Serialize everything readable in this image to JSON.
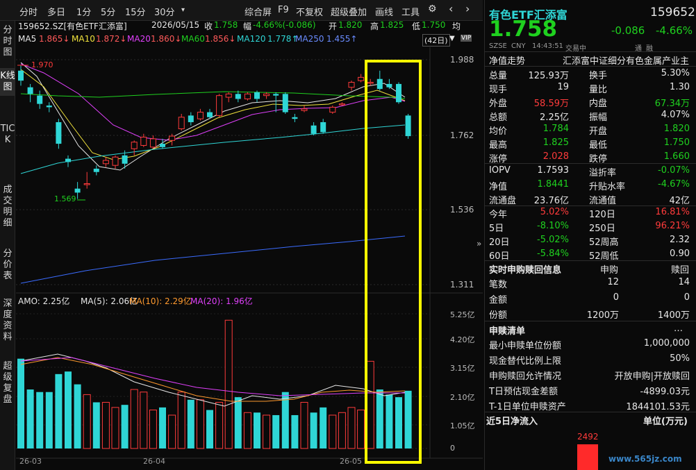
{
  "toolbar": {
    "tabs": [
      "分时",
      "多日",
      "1分",
      "5分",
      "15分",
      "30分"
    ],
    "more_icon": "▾",
    "right_items": [
      "综合屏",
      "F9",
      "不复权",
      "超级叠加",
      "画线",
      "工具"
    ],
    "gear_icon": "⚙",
    "nav_icons": [
      "‹",
      "›"
    ]
  },
  "vtabs": [
    "分时图",
    "K线图",
    "TICK",
    "成交明细",
    "分价表",
    "深度资料",
    "超级复盘"
  ],
  "info": {
    "code_name": "159652.SZ[有色ETF汇添富]",
    "date": "2026/05/15",
    "close_label": "收",
    "close": "1.758",
    "amp_label": "幅",
    "amp": "-4.66%(-0.086)",
    "open_label": "开",
    "open": "1.820",
    "high_label": "高",
    "high": "1.825",
    "low_label": "低",
    "low": "1.750",
    "more": "均"
  },
  "ma": {
    "ma5_label": "MA5",
    "ma5": "1.865↓",
    "ma10_label": "MA10",
    "ma10": "1.872↓",
    "ma20_label": "MA20",
    "ma20": "1.860↓",
    "ma60_label": "MA60",
    "ma60": "1.856↓",
    "ma120_label": "MA120",
    "ma120": "1.778↑",
    "ma250_label": "MA250",
    "ma250": "1.455↑",
    "period": "(42日)",
    "colors": {
      "ma5": "#e8e8e8",
      "ma10": "#f0e23c",
      "ma20": "#e040fb",
      "ma60": "#1fd11f",
      "ma120": "#2fd6d6",
      "ma250": "#3b6cff"
    }
  },
  "price_axis": [
    "1.988",
    "1.762",
    "1.536",
    "1.311"
  ],
  "annot": {
    "high": "1.970",
    "low": "1.569"
  },
  "amo": {
    "amo_label": "AMO: 2.25亿",
    "ma5_label": "MA(5): 2.06亿",
    "ma10_label": "MA(10): 2.29亿",
    "ma20_label": "MA(20): 1.96亿"
  },
  "vol_axis": [
    "5.25亿",
    "4.20亿",
    "3.15亿",
    "2.10亿",
    "1.05亿",
    "0"
  ],
  "date_axis": [
    "26-03",
    "26-04",
    "26-05"
  ],
  "stock": {
    "name": "有色ETF汇添富",
    "code": "159652",
    "price": "1.758",
    "change": "-0.086",
    "change_pct": "-4.66%",
    "market": "SZSE",
    "currency": "CNY",
    "time": "14:43:51",
    "status": "交易中",
    "flags": [
      "通",
      "融"
    ]
  },
  "panel": {
    "nav_label": "净值走势",
    "nav_desc": "汇添富中证细分有色金属产业主",
    "rows_a": [
      {
        "k1": "总量",
        "v1": "125.93万",
        "k2": "换手",
        "v2": "5.30%"
      },
      {
        "k1": "现手",
        "v1": "19",
        "k2": "量比",
        "v2": "1.30"
      },
      {
        "k1": "外盘",
        "v1": "58.59万",
        "k2": "内盘",
        "v2": "67.34万"
      },
      {
        "k1": "总额",
        "v1": "2.25亿",
        "k2": "振幅",
        "v2": "4.07%"
      },
      {
        "k1": "均价",
        "v1": "1.784",
        "k2": "开盘",
        "v2": "1.820"
      },
      {
        "k1": "最高",
        "v1": "1.825",
        "k2": "最低",
        "v2": "1.750"
      },
      {
        "k1": "涨停",
        "v1": "2.028",
        "k2": "跌停",
        "v2": "1.660"
      }
    ],
    "rows_b": [
      {
        "k1": "IOPV",
        "v1": "1.7593",
        "k2": "溢折率",
        "v2": "-0.07%"
      },
      {
        "k1": "净值",
        "v1": "1.8441",
        "k2": "升贴水率",
        "v2": "-4.67%"
      },
      {
        "k1": "流通盘",
        "v1": "23.76亿",
        "k2": "流通值",
        "v2": "42亿"
      }
    ],
    "rows_c": [
      {
        "k1": "今年",
        "v1": "5.02%",
        "k2": "120日",
        "v2": "16.81%"
      },
      {
        "k1": "5日",
        "v1": "-8.10%",
        "k2": "250日",
        "v2": "96.21%"
      },
      {
        "k1": "20日",
        "v1": "-5.02%",
        "k2": "52周高",
        "v2": "2.32"
      },
      {
        "k1": "60日",
        "v1": "-5.84%",
        "k2": "52周低",
        "v2": "0.90"
      }
    ],
    "sub_title": "实时申购赎回信息",
    "sub_col1": "申购",
    "sub_col2": "赎回",
    "sub_rows": [
      {
        "k": "笔数",
        "v1": "12",
        "v2": "14"
      },
      {
        "k": "金额",
        "v1": "0",
        "v2": "0"
      },
      {
        "k": "份额",
        "v1": "1200万",
        "v2": "1400万"
      }
    ],
    "list_title": "申赎清单",
    "list_more": "…",
    "list_rows": [
      {
        "k": "最小申赎单位份额",
        "v": "1,000,000"
      },
      {
        "k": "现金替代比例上限",
        "v": "50%"
      },
      {
        "k": "申购赎回允许情况",
        "v": "开放申购|开放赎回"
      },
      {
        "k": "T日预估现金差额",
        "v": "-4899.03元"
      },
      {
        "k": "T-1日单位申赎资产",
        "v": "1844101.53元"
      }
    ],
    "flow_title": "近5日净流入",
    "flow_unit": "单位(万元)",
    "flow_value": "2492",
    "watermark": "www.565jz.com"
  }
}
